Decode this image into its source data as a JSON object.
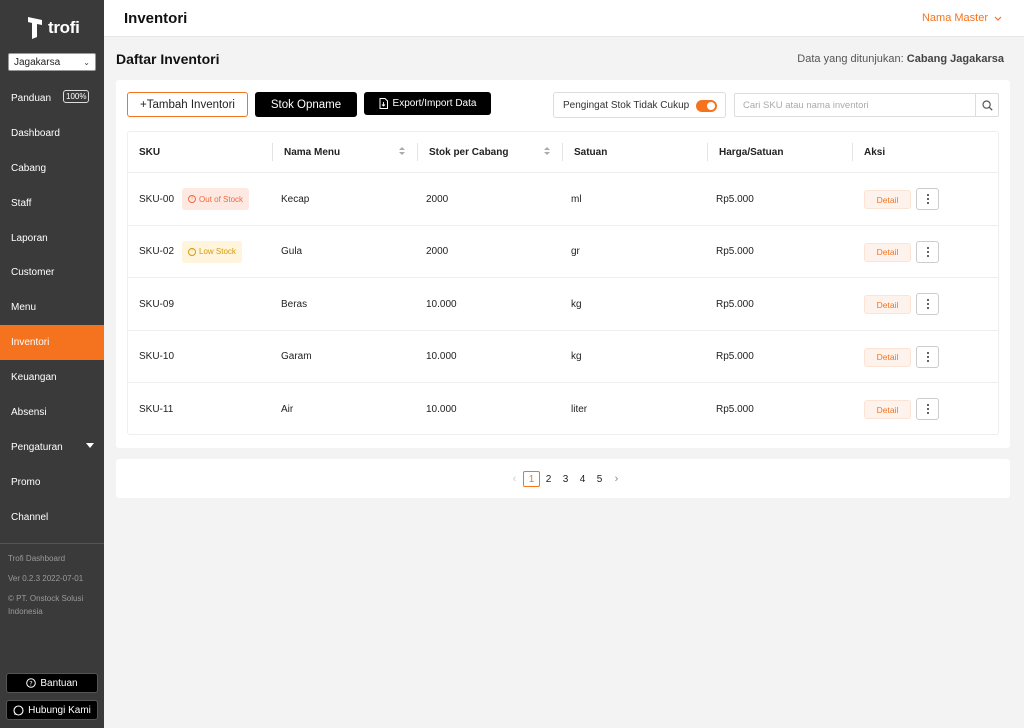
{
  "sidebar": {
    "logo_text": "trofi",
    "branch": "Jagakarsa",
    "items": [
      {
        "label": "Panduan",
        "badge": "100%"
      },
      {
        "label": "Dashboard"
      },
      {
        "label": "Cabang"
      },
      {
        "label": "Staff"
      },
      {
        "label": "Laporan"
      },
      {
        "label": "Customer"
      },
      {
        "label": "Menu"
      },
      {
        "label": "Inventori",
        "active": true
      },
      {
        "label": "Keuangan"
      },
      {
        "label": "Absensi"
      },
      {
        "label": "Pengaturan",
        "has_caret": true
      },
      {
        "label": "Promo"
      },
      {
        "label": "Channel"
      }
    ],
    "footer": {
      "app_name": "Trofi Dashboard",
      "version": "Ver 0.2.3 2022-07-01",
      "company": "© PT. Onstock Solusi Indonesia"
    },
    "help_label": "Bantuan",
    "contact_label": "Hubungi Kami"
  },
  "header": {
    "title": "Inventori",
    "user": "Nama Master"
  },
  "page": {
    "title": "Daftar Inventori",
    "data_prefix": "Data yang ditunjukan:",
    "data_branch": "Cabang Jagakarsa"
  },
  "toolbar": {
    "add_label": "+Tambah Inventori",
    "opname_label": "Stok Opname",
    "export_label": "Export/Import Data",
    "toggle_label": "Pengingat Stok Tidak Cukup",
    "search_placeholder": "Cari SKU atau nama inventori"
  },
  "table": {
    "headers": [
      "SKU",
      "Nama Menu",
      "Stok per Cabang",
      "Satuan",
      "Harga/Satuan",
      "Aksi"
    ],
    "detail_label": "Detail",
    "rows": [
      {
        "sku": "SKU-00",
        "status": "Out of Stock",
        "status_type": "out",
        "name": "Kecap",
        "stock": "2000",
        "unit": "ml",
        "price": "Rp5.000"
      },
      {
        "sku": "SKU-02",
        "status": "Low Stock",
        "status_type": "low",
        "name": "Gula",
        "stock": "2000",
        "unit": "gr",
        "price": "Rp5.000"
      },
      {
        "sku": "SKU-09",
        "status": "",
        "status_type": "",
        "name": "Beras",
        "stock": "10.000",
        "unit": "kg",
        "price": "Rp5.000"
      },
      {
        "sku": "SKU-10",
        "status": "",
        "status_type": "",
        "name": "Garam",
        "stock": "10.000",
        "unit": "kg",
        "price": "Rp5.000"
      },
      {
        "sku": "SKU-11",
        "status": "",
        "status_type": "",
        "name": "Air",
        "stock": "10.000",
        "unit": "liter",
        "price": "Rp5.000"
      }
    ]
  },
  "pagination": {
    "pages": [
      "1",
      "2",
      "3",
      "4",
      "5"
    ],
    "current": "1"
  },
  "colors": {
    "accent": "#f5731e",
    "sidebar_bg": "#3a3a3a",
    "out_of_stock": "#f26a3e",
    "low_stock": "#d39a13"
  },
  "icons": {
    "search": "search-icon",
    "export": "file-icon",
    "more": "more-vertical-icon",
    "help": "help-circle-icon",
    "contact": "whatsapp-icon"
  }
}
